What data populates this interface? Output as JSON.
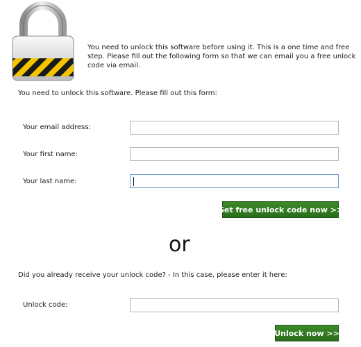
{
  "intro_text": "You need to unlock this software before using it. This is a one time and free step. Please fill out the following form so that we can email you a free unlock code via email.",
  "form": {
    "lead": "You need to unlock this software. Please fill out this form:",
    "email_label": "Your email address:",
    "email_value": "",
    "first_name_label": "Your first name:",
    "first_name_value": "",
    "last_name_label": "Your last name:",
    "last_name_value": "",
    "submit_label": "Get free unlock code now >>"
  },
  "separator": "or",
  "unlock": {
    "question": "Did you already receive your unlock code? - In this case, please enter it here:",
    "code_label": "Unlock code:",
    "code_value": "",
    "submit_label": "Unlock now >>"
  },
  "icons": {
    "lock": "padlock-hazard-icon"
  },
  "colors": {
    "button": "#2f7a21",
    "hazard_yellow": "#f5c400",
    "hazard_black": "#1a1a1a"
  }
}
